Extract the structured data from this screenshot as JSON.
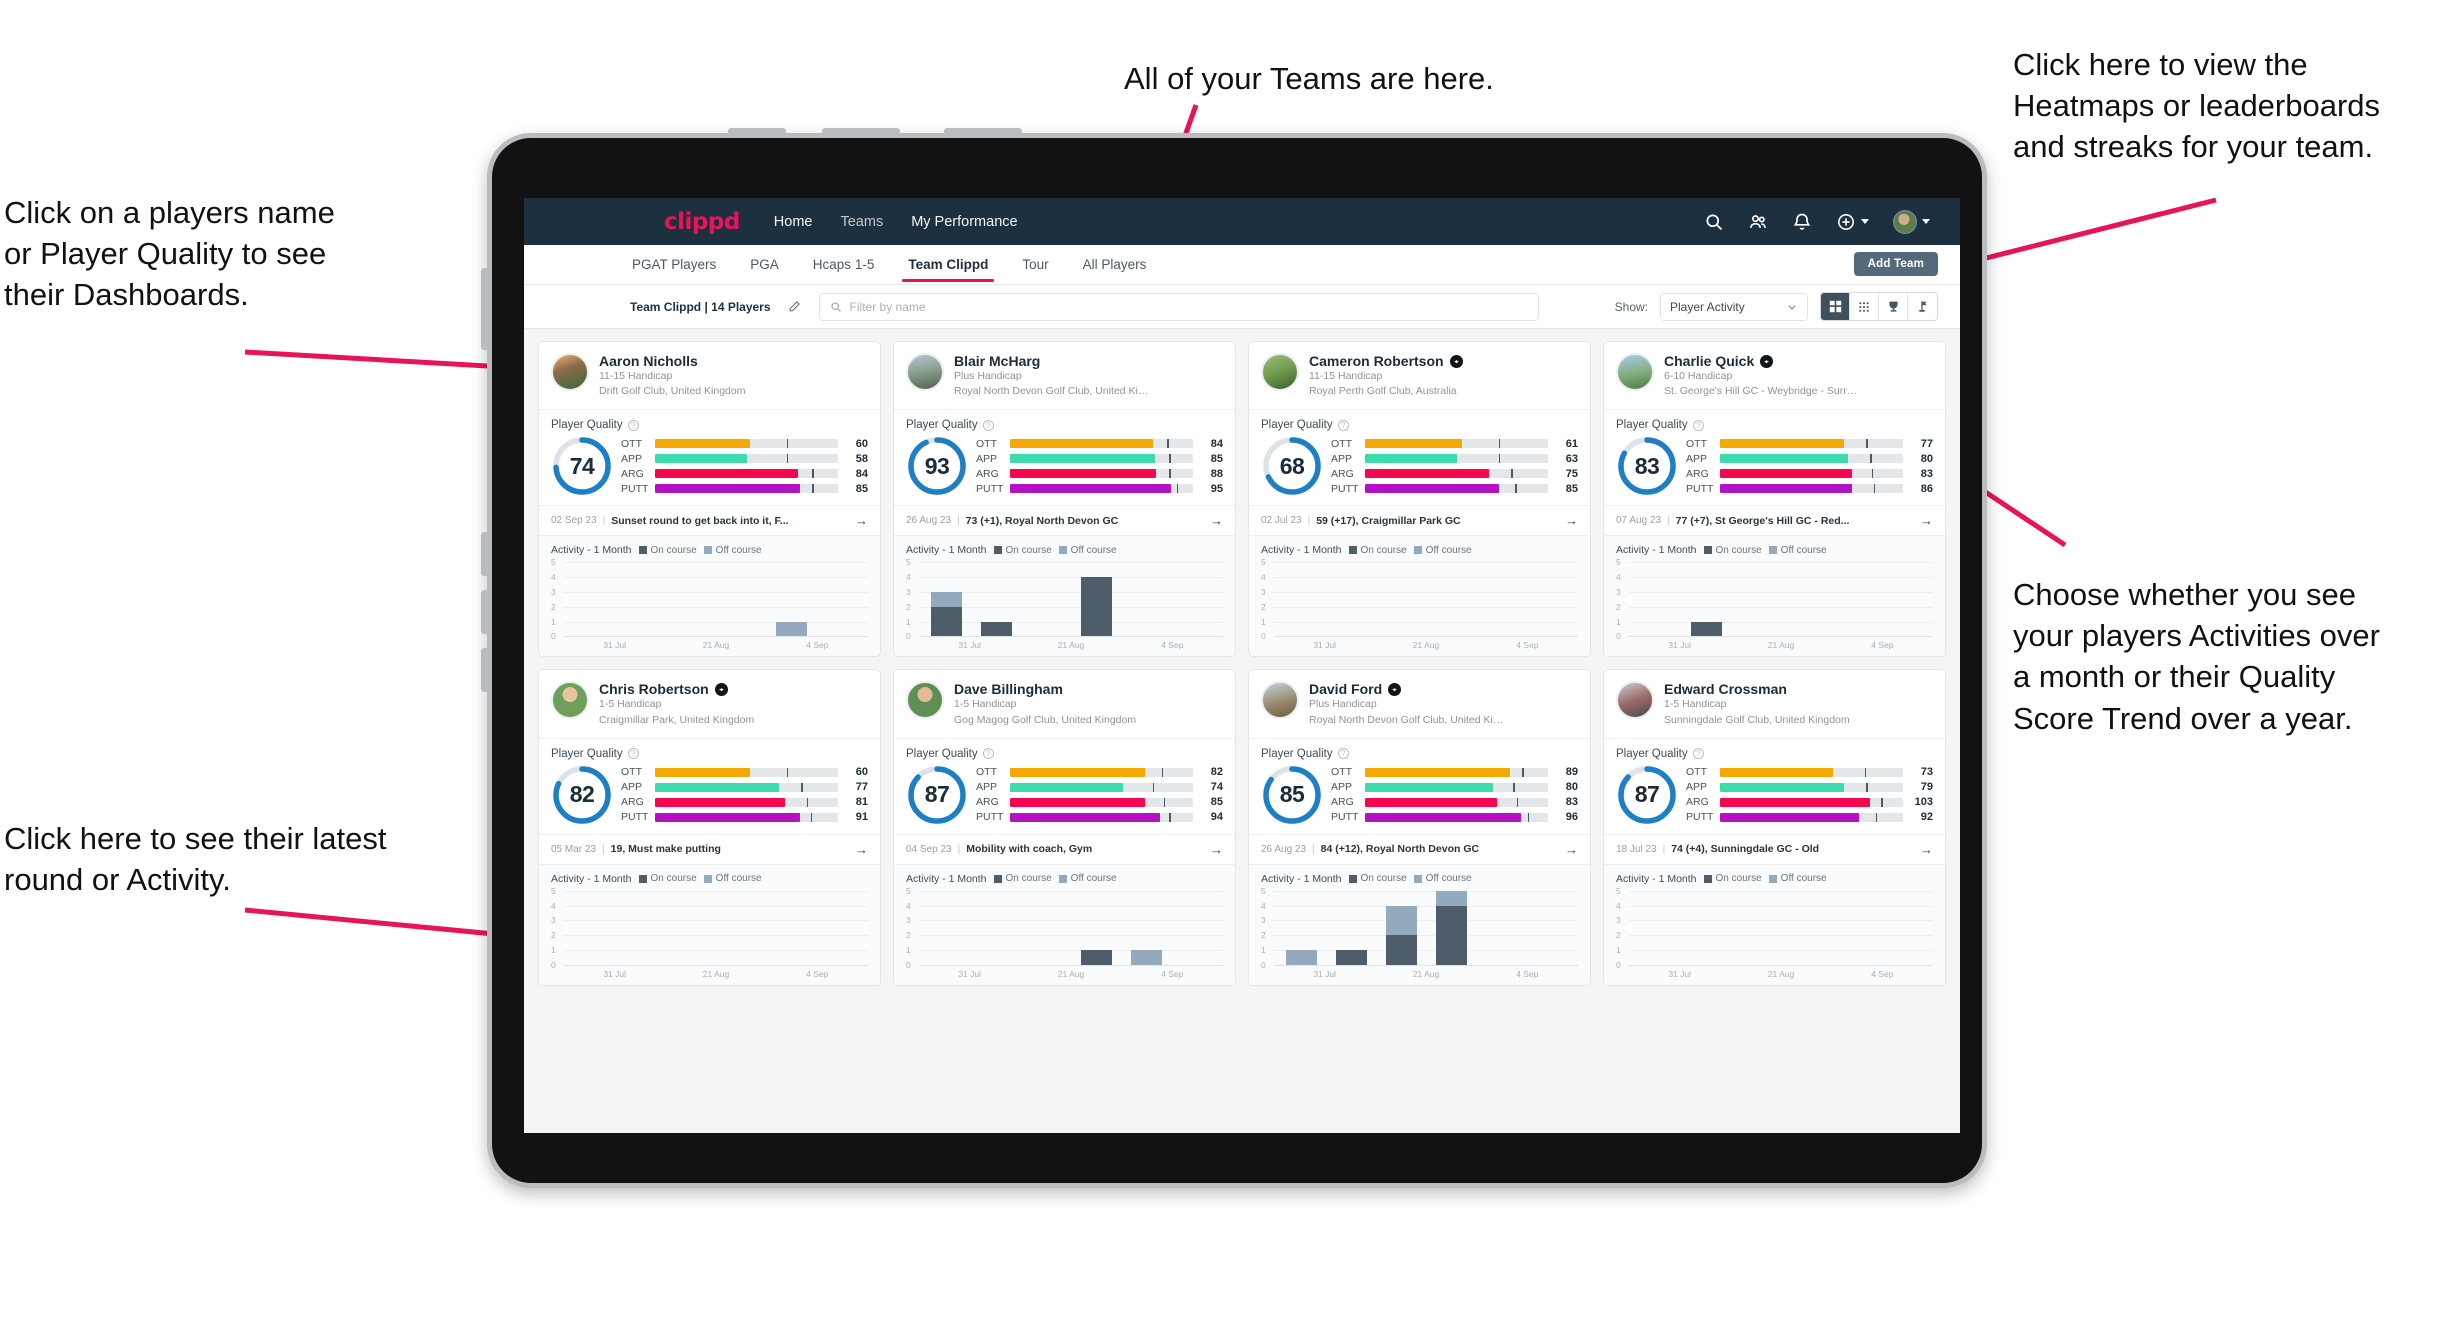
{
  "annotations": {
    "teams": "All of your Teams are here.",
    "heatmaps": "Click here to view the\nHeatmaps or leaderboards\nand streaks for your team.",
    "dashboards": "Click on a players name\nor Player Quality to see\ntheir Dashboards.",
    "choose": "Choose whether you see\nyour players Activities over\na month or their Quality\nScore Trend over a year.",
    "latest_round": "Click here to see their latest\nround or Activity."
  },
  "topnav": {
    "logo": "clippd",
    "links": [
      "Home",
      "Teams",
      "My Performance"
    ],
    "icons": [
      "search-icon",
      "people-icon",
      "bell-icon",
      "plus-circle-icon",
      "avatar"
    ]
  },
  "tabs": [
    {
      "label": "PGAT Players",
      "active": false
    },
    {
      "label": "PGA",
      "active": false
    },
    {
      "label": "Hcaps 1-5",
      "active": false
    },
    {
      "label": "Team Clippd",
      "active": true
    },
    {
      "label": "Tour",
      "active": false
    },
    {
      "label": "All Players",
      "active": false
    }
  ],
  "add_team_label": "Add Team",
  "filterbar": {
    "team_label": "Team Clippd | 14 Players",
    "search_placeholder": "Filter by name",
    "search_value": "",
    "show_label": "Show:",
    "show_value": "Player Activity",
    "view_buttons": [
      {
        "name": "card-view",
        "active": true
      },
      {
        "name": "grid-view",
        "active": false
      },
      {
        "name": "leaderboard-view",
        "active": false
      },
      {
        "name": "streaks-view",
        "active": false
      }
    ]
  },
  "card_labels": {
    "quality_title": "Player Quality",
    "activity_title": "Activity - 1 Month",
    "legend_on": "On course",
    "legend_off": "Off course",
    "metric_names": [
      "OTT",
      "APP",
      "ARG",
      "PUTT"
    ],
    "x_ticks": [
      "31 Jul",
      "21 Aug",
      "4 Sep"
    ],
    "y_ticks": [
      "5",
      "4",
      "3",
      "2",
      "1",
      "0"
    ]
  },
  "metric_colors": {
    "OTT": "#f5a800",
    "APP": "#3ddbab",
    "ARG": "#f5074f",
    "PUTT": "#b511c4",
    "track": "#e3e7ea",
    "ring": "#1f7fc4",
    "ring_bg": "#dde3e8"
  },
  "players": [
    {
      "name": "Aaron Nicholls",
      "verified": false,
      "handicap": "11-15 Handicap",
      "club": "Drift Golf Club, United Kingdom",
      "quality": 74,
      "metrics": [
        {
          "label": "OTT",
          "value": 60,
          "fill": 52,
          "tick": 72
        },
        {
          "label": "APP",
          "value": 58,
          "fill": 50,
          "tick": 72
        },
        {
          "label": "ARG",
          "value": 84,
          "fill": 78,
          "tick": 86
        },
        {
          "label": "PUTT",
          "value": 85,
          "fill": 79,
          "tick": 86
        }
      ],
      "round_date": "02 Sep 23",
      "round_text": "Sunset round to get back into it, F...",
      "activity": [
        {
          "on": 0,
          "off": 0
        },
        {
          "on": 0,
          "off": 0
        },
        {
          "on": 0,
          "off": 0
        },
        {
          "on": 0,
          "off": 0
        },
        {
          "on": 0,
          "off": 1
        },
        {
          "on": 0,
          "off": 0
        }
      ]
    },
    {
      "name": "Blair McHarg",
      "verified": false,
      "handicap": "Plus Handicap",
      "club": "Royal North Devon Golf Club, United Kin...",
      "quality": 93,
      "metrics": [
        {
          "label": "OTT",
          "value": 84,
          "fill": 78,
          "tick": 86
        },
        {
          "label": "APP",
          "value": 85,
          "fill": 79,
          "tick": 87
        },
        {
          "label": "ARG",
          "value": 88,
          "fill": 80,
          "tick": 87
        },
        {
          "label": "PUTT",
          "value": 95,
          "fill": 88,
          "tick": 91
        }
      ],
      "round_date": "26 Aug 23",
      "round_text": "73 (+1), Royal North Devon GC",
      "activity": [
        {
          "on": 2,
          "off": 1
        },
        {
          "on": 1,
          "off": 0
        },
        {
          "on": 0,
          "off": 0
        },
        {
          "on": 4,
          "off": 0
        },
        {
          "on": 0,
          "off": 0
        },
        {
          "on": 0,
          "off": 0
        }
      ]
    },
    {
      "name": "Cameron Robertson",
      "verified": true,
      "handicap": "11-15 Handicap",
      "club": "Royal Perth Golf Club, Australia",
      "quality": 68,
      "metrics": [
        {
          "label": "OTT",
          "value": 61,
          "fill": 53,
          "tick": 73
        },
        {
          "label": "APP",
          "value": 63,
          "fill": 50,
          "tick": 73
        },
        {
          "label": "ARG",
          "value": 75,
          "fill": 68,
          "tick": 80
        },
        {
          "label": "PUTT",
          "value": 85,
          "fill": 73,
          "tick": 82
        }
      ],
      "round_date": "02 Jul 23",
      "round_text": "59 (+17), Craigmillar Park GC",
      "activity": [
        {
          "on": 0,
          "off": 0
        },
        {
          "on": 0,
          "off": 0
        },
        {
          "on": 0,
          "off": 0
        },
        {
          "on": 0,
          "off": 0
        },
        {
          "on": 0,
          "off": 0
        },
        {
          "on": 0,
          "off": 0
        }
      ]
    },
    {
      "name": "Charlie Quick",
      "verified": true,
      "handicap": "6-10 Handicap",
      "club": "St. George's Hill GC - Weybridge - Surrey, ...",
      "quality": 83,
      "metrics": [
        {
          "label": "OTT",
          "value": 77,
          "fill": 68,
          "tick": 80
        },
        {
          "label": "APP",
          "value": 80,
          "fill": 70,
          "tick": 82
        },
        {
          "label": "ARG",
          "value": 83,
          "fill": 72,
          "tick": 83
        },
        {
          "label": "PUTT",
          "value": 86,
          "fill": 72,
          "tick": 84
        }
      ],
      "round_date": "07 Aug 23",
      "round_text": "77 (+7), St George's Hill GC - Red...",
      "activity": [
        {
          "on": 0,
          "off": 0
        },
        {
          "on": 1,
          "off": 0
        },
        {
          "on": 0,
          "off": 0
        },
        {
          "on": 0,
          "off": 0
        },
        {
          "on": 0,
          "off": 0
        },
        {
          "on": 0,
          "off": 0
        }
      ]
    },
    {
      "name": "Chris Robertson",
      "verified": true,
      "handicap": "1-5 Handicap",
      "club": "Craigmillar Park, United Kingdom",
      "quality": 82,
      "metrics": [
        {
          "label": "OTT",
          "value": 60,
          "fill": 52,
          "tick": 72
        },
        {
          "label": "APP",
          "value": 77,
          "fill": 68,
          "tick": 80
        },
        {
          "label": "ARG",
          "value": 81,
          "fill": 71,
          "tick": 83
        },
        {
          "label": "PUTT",
          "value": 91,
          "fill": 79,
          "tick": 85
        }
      ],
      "round_date": "05 Mar 23",
      "round_text": "19, Must make putting",
      "activity": [
        {
          "on": 0,
          "off": 0
        },
        {
          "on": 0,
          "off": 0
        },
        {
          "on": 0,
          "off": 0
        },
        {
          "on": 0,
          "off": 0
        },
        {
          "on": 0,
          "off": 0
        },
        {
          "on": 0,
          "off": 0
        }
      ]
    },
    {
      "name": "Dave Billingham",
      "verified": false,
      "handicap": "1-5 Handicap",
      "club": "Gog Magog Golf Club, United Kingdom",
      "quality": 87,
      "metrics": [
        {
          "label": "OTT",
          "value": 82,
          "fill": 74,
          "tick": 83
        },
        {
          "label": "APP",
          "value": 74,
          "fill": 62,
          "tick": 78
        },
        {
          "label": "ARG",
          "value": 85,
          "fill": 74,
          "tick": 84
        },
        {
          "label": "PUTT",
          "value": 94,
          "fill": 82,
          "tick": 87
        }
      ],
      "round_date": "04 Sep 23",
      "round_text": "Mobility with coach, Gym",
      "activity": [
        {
          "on": 0,
          "off": 0
        },
        {
          "on": 0,
          "off": 0
        },
        {
          "on": 0,
          "off": 0
        },
        {
          "on": 1,
          "off": 0
        },
        {
          "on": 0,
          "off": 1
        },
        {
          "on": 0,
          "off": 0
        }
      ]
    },
    {
      "name": "David Ford",
      "verified": true,
      "handicap": "Plus Handicap",
      "club": "Royal North Devon Golf Club, United Kin...",
      "quality": 85,
      "metrics": [
        {
          "label": "OTT",
          "value": 89,
          "fill": 79,
          "tick": 86
        },
        {
          "label": "APP",
          "value": 80,
          "fill": 70,
          "tick": 81
        },
        {
          "label": "ARG",
          "value": 83,
          "fill": 72,
          "tick": 83
        },
        {
          "label": "PUTT",
          "value": 96,
          "fill": 85,
          "tick": 89
        }
      ],
      "round_date": "26 Aug 23",
      "round_text": "84 (+12), Royal North Devon GC",
      "activity": [
        {
          "on": 0,
          "off": 1
        },
        {
          "on": 1,
          "off": 0
        },
        {
          "on": 2,
          "off": 2
        },
        {
          "on": 4,
          "off": 1
        },
        {
          "on": 0,
          "off": 0
        },
        {
          "on": 0,
          "off": 0
        }
      ]
    },
    {
      "name": "Edward Crossman",
      "verified": false,
      "handicap": "1-5 Handicap",
      "club": "Sunningdale Golf Club, United Kingdom",
      "quality": 87,
      "metrics": [
        {
          "label": "OTT",
          "value": 73,
          "fill": 62,
          "tick": 79
        },
        {
          "label": "APP",
          "value": 79,
          "fill": 68,
          "tick": 80
        },
        {
          "label": "ARG",
          "value": 103,
          "fill": 82,
          "tick": 88
        },
        {
          "label": "PUTT",
          "value": 92,
          "fill": 76,
          "tick": 85
        }
      ],
      "round_date": "18 Jul 23",
      "round_text": "74 (+4), Sunningdale GC - Old",
      "activity": [
        {
          "on": 0,
          "off": 0
        },
        {
          "on": 0,
          "off": 0
        },
        {
          "on": 0,
          "off": 0
        },
        {
          "on": 0,
          "off": 0
        },
        {
          "on": 0,
          "off": 0
        },
        {
          "on": 0,
          "off": 0
        }
      ]
    }
  ]
}
